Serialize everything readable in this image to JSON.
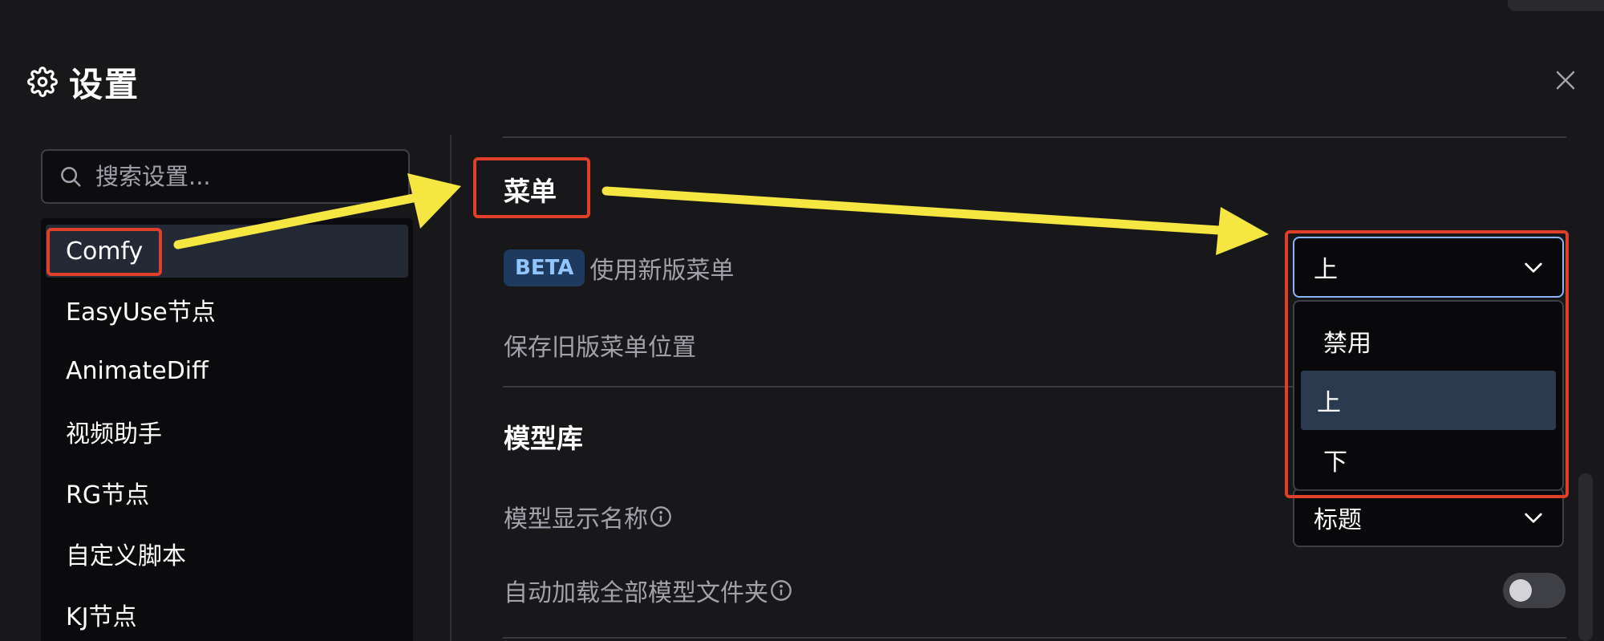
{
  "dialog": {
    "title": "设置",
    "close_icon": "close-icon",
    "gear_icon": "gear-icon"
  },
  "sidebar": {
    "search": {
      "placeholder": "搜索设置...",
      "value": "",
      "icon": "search-icon"
    },
    "items": [
      {
        "label": "Comfy",
        "active": true
      },
      {
        "label": "EasyUse节点",
        "active": false
      },
      {
        "label": "AnimateDiff",
        "active": false
      },
      {
        "label": "视频助手",
        "active": false
      },
      {
        "label": "RG节点",
        "active": false
      },
      {
        "label": "自定义脚本",
        "active": false
      },
      {
        "label": "KJ节点",
        "active": false
      }
    ]
  },
  "main": {
    "menu_section": {
      "title": "菜单",
      "use_new_menu": {
        "badge": "BETA",
        "label": "使用新版菜单",
        "selected": "上",
        "options": [
          "禁用",
          "上",
          "下"
        ]
      },
      "keep_old_menu_position": {
        "label": "保存旧版菜单位置"
      }
    },
    "model_library_section": {
      "title": "模型库",
      "model_display_name": {
        "label": "模型显示名称",
        "value": "标题",
        "info_icon": "info-icon"
      },
      "auto_load_all_model_folders": {
        "label": "自动加载全部模型文件夹",
        "info_icon": "info-icon",
        "enabled": false
      }
    }
  },
  "colors": {
    "background": "#18181b",
    "annotation_box": "#e0402a",
    "annotation_arrow": "#f5e642",
    "beta_badge_bg": "#1e3a5f",
    "beta_badge_text": "#93c5fd",
    "focus_border": "#8ab4f8",
    "selected_option_bg": "#2c3a50"
  }
}
